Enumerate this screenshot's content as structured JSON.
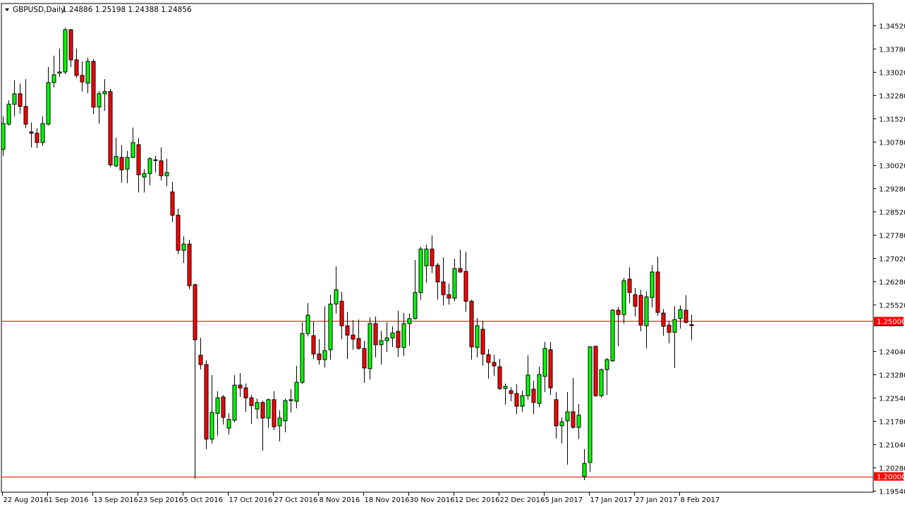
{
  "header": {
    "symbol": "GBPUSD,Daily",
    "ohlc_text": "1.24886 1.25198 1.24388 1.24856"
  },
  "colors": {
    "bull": "#00ff00",
    "bear": "#ff0000",
    "outline": "#000000",
    "hline": "#ff0000"
  },
  "chart_data": {
    "type": "candlestick",
    "title": "GBPUSD,Daily",
    "ylim": [
      1.1954,
      1.35
    ],
    "y_ticks": [
      "1.34520",
      "1.33780",
      "1.33020",
      "1.32280",
      "1.31520",
      "1.30780",
      "1.30020",
      "1.29280",
      "1.28520",
      "1.27780",
      "1.27020",
      "1.26280",
      "1.25520",
      "1.24040",
      "1.23280",
      "1.22540",
      "1.21780",
      "1.21040",
      "1.20280",
      "1.19540"
    ],
    "x_ticks": [
      {
        "label": "22 Aug 2016",
        "index": 0
      },
      {
        "label": "1 Sep 2016",
        "index": 8
      },
      {
        "label": "13 Sep 2016",
        "index": 16
      },
      {
        "label": "23 Sep 2016",
        "index": 24
      },
      {
        "label": "5 Oct 2016",
        "index": 32
      },
      {
        "label": "17 Oct 2016",
        "index": 40
      },
      {
        "label": "27 Oct 2016",
        "index": 48
      },
      {
        "label": "8 Nov 2016",
        "index": 56
      },
      {
        "label": "18 Nov 2016",
        "index": 64
      },
      {
        "label": "30 Nov 2016",
        "index": 72
      },
      {
        "label": "12 Dec 2016",
        "index": 80
      },
      {
        "label": "22 Dec 2016",
        "index": 88
      },
      {
        "label": "5 Jan 2017",
        "index": 96
      },
      {
        "label": "17 Jan 2017",
        "index": 104
      },
      {
        "label": "27 Jan 2017",
        "index": 112
      },
      {
        "label": "8 Feb 2017",
        "index": 120
      }
    ],
    "horizontal_lines": [
      {
        "price": 1.25,
        "label": "1.25000"
      },
      {
        "price": 1.2,
        "label": "1.20000"
      }
    ],
    "last_price": {
      "price": 1.24856,
      "label": "1.24856"
    },
    "ohlc_fields": [
      "open",
      "high",
      "low",
      "close"
    ],
    "candles": [
      [
        1.3053,
        1.3159,
        1.3032,
        1.3136
      ],
      [
        1.3134,
        1.3211,
        1.313,
        1.3198
      ],
      [
        1.3198,
        1.3275,
        1.3159,
        1.3232
      ],
      [
        1.3232,
        1.3264,
        1.3168,
        1.3191
      ],
      [
        1.3191,
        1.3279,
        1.3121,
        1.3134
      ],
      [
        1.3109,
        1.3139,
        1.3059,
        1.3105
      ],
      [
        1.3105,
        1.3121,
        1.3057,
        1.3075
      ],
      [
        1.3075,
        1.3159,
        1.3064,
        1.3136
      ],
      [
        1.3134,
        1.3318,
        1.313,
        1.3268
      ],
      [
        1.3268,
        1.3354,
        1.3252,
        1.3293
      ],
      [
        1.3298,
        1.3377,
        1.3286,
        1.3302
      ],
      [
        1.3302,
        1.3445,
        1.3295,
        1.3438
      ],
      [
        1.3438,
        1.3441,
        1.3318,
        1.3341
      ],
      [
        1.3341,
        1.3377,
        1.3284,
        1.3291
      ],
      [
        1.3291,
        1.3336,
        1.3239,
        1.327
      ],
      [
        1.3266,
        1.3348,
        1.3234,
        1.3336
      ],
      [
        1.3336,
        1.3343,
        1.3166,
        1.3189
      ],
      [
        1.3189,
        1.3241,
        1.3136,
        1.3232
      ],
      [
        1.3232,
        1.3279,
        1.3177,
        1.3239
      ],
      [
        1.3239,
        1.3248,
        1.2996,
        1.3003
      ],
      [
        1.3,
        1.3091,
        1.2996,
        1.303
      ],
      [
        1.3027,
        1.3066,
        1.2946,
        1.2987
      ],
      [
        1.2989,
        1.3048,
        1.2944,
        1.3027
      ],
      [
        1.3027,
        1.3123,
        1.3025,
        1.3075
      ],
      [
        1.3068,
        1.3089,
        1.2914,
        1.2971
      ],
      [
        1.2964,
        1.2989,
        1.2914,
        1.2975
      ],
      [
        1.2975,
        1.3027,
        1.2937,
        1.3023
      ],
      [
        1.3018,
        1.3032,
        1.2978,
        1.3019
      ],
      [
        1.3016,
        1.3059,
        1.2953,
        1.2968
      ],
      [
        1.2968,
        1.3023,
        1.2934,
        1.2978
      ],
      [
        1.2916,
        1.2948,
        1.2819,
        1.2841
      ],
      [
        1.2841,
        1.2862,
        1.2716,
        1.2728
      ],
      [
        1.2728,
        1.2773,
        1.2687,
        1.2748
      ],
      [
        1.2748,
        1.2762,
        1.2603,
        1.2614
      ],
      [
        1.2617,
        1.2621,
        1.1992,
        1.244
      ],
      [
        1.239,
        1.2446,
        1.2344,
        1.236
      ],
      [
        1.236,
        1.2374,
        1.2088,
        1.212
      ],
      [
        1.212,
        1.2326,
        1.2106,
        1.2206
      ],
      [
        1.2203,
        1.2274,
        1.2131,
        1.2253
      ],
      [
        1.2256,
        1.2262,
        1.2167,
        1.219
      ],
      [
        1.2156,
        1.2203,
        1.2135,
        1.2183
      ],
      [
        1.2181,
        1.2326,
        1.2174,
        1.2294
      ],
      [
        1.2294,
        1.2333,
        1.2256,
        1.2285
      ],
      [
        1.2285,
        1.2299,
        1.2208,
        1.2253
      ],
      [
        1.2253,
        1.2262,
        1.2169,
        1.2228
      ],
      [
        1.2217,
        1.2251,
        1.2185,
        1.2238
      ],
      [
        1.2238,
        1.2244,
        1.2083,
        1.2188
      ],
      [
        1.2188,
        1.2251,
        1.2156,
        1.2247
      ],
      [
        1.2247,
        1.2274,
        1.2149,
        1.216
      ],
      [
        1.2163,
        1.2213,
        1.2113,
        1.2188
      ],
      [
        1.2179,
        1.2251,
        1.2142,
        1.2244
      ],
      [
        1.2244,
        1.2281,
        1.2206,
        1.2247
      ],
      [
        1.2242,
        1.2356,
        1.2219,
        1.2303
      ],
      [
        1.2303,
        1.2496,
        1.2297,
        1.246
      ],
      [
        1.246,
        1.2558,
        1.2451,
        1.2519
      ],
      [
        1.2453,
        1.2499,
        1.2378,
        1.2394
      ],
      [
        1.2394,
        1.2442,
        1.236,
        1.2376
      ],
      [
        1.2376,
        1.2548,
        1.2351,
        1.2405
      ],
      [
        1.2408,
        1.2585,
        1.2376,
        1.2555
      ],
      [
        1.2555,
        1.2676,
        1.2524,
        1.2601
      ],
      [
        1.2564,
        1.2594,
        1.2442,
        1.2485
      ],
      [
        1.2485,
        1.253,
        1.2378,
        1.2455
      ],
      [
        1.2455,
        1.2503,
        1.2408,
        1.2442
      ],
      [
        1.2444,
        1.2505,
        1.2408,
        1.2412
      ],
      [
        1.2412,
        1.2437,
        1.2301,
        1.2349
      ],
      [
        1.2347,
        1.2512,
        1.2312,
        1.2492
      ],
      [
        1.2492,
        1.2515,
        1.2383,
        1.2424
      ],
      [
        1.2424,
        1.2469,
        1.236,
        1.2437
      ],
      [
        1.2437,
        1.2496,
        1.2401,
        1.2446
      ],
      [
        1.2446,
        1.2483,
        1.2417,
        1.2462
      ],
      [
        1.2467,
        1.2533,
        1.2385,
        1.2415
      ],
      [
        1.2415,
        1.2526,
        1.2387,
        1.2492
      ],
      [
        1.2492,
        1.2524,
        1.2421,
        1.2508
      ],
      [
        1.2508,
        1.2696,
        1.2505,
        1.2592
      ],
      [
        1.2592,
        1.2739,
        1.2569,
        1.2732
      ],
      [
        1.2678,
        1.2746,
        1.2623,
        1.2732
      ],
      [
        1.2732,
        1.2776,
        1.2655,
        1.2678
      ],
      [
        1.268,
        1.2687,
        1.2569,
        1.2626
      ],
      [
        1.2626,
        1.2705,
        1.2551,
        1.2585
      ],
      [
        1.2585,
        1.2621,
        1.2553,
        1.2574
      ],
      [
        1.2574,
        1.2701,
        1.2564,
        1.2669
      ],
      [
        1.2669,
        1.273,
        1.2655,
        1.2658
      ],
      [
        1.266,
        1.2723,
        1.253,
        1.2564
      ],
      [
        1.2564,
        1.2569,
        1.2376,
        1.2417
      ],
      [
        1.2415,
        1.251,
        1.2383,
        1.2485
      ],
      [
        1.2474,
        1.2501,
        1.2356,
        1.2394
      ],
      [
        1.2392,
        1.241,
        1.2315,
        1.2367
      ],
      [
        1.2367,
        1.2392,
        1.2324,
        1.2356
      ],
      [
        1.2353,
        1.2378,
        1.2278,
        1.2283
      ],
      [
        1.2283,
        1.2299,
        1.2231,
        1.229
      ],
      [
        1.2276,
        1.2287,
        1.2242,
        1.2267
      ],
      [
        1.2267,
        1.2297,
        1.2201,
        1.2226
      ],
      [
        1.2226,
        1.2276,
        1.2208,
        1.226
      ],
      [
        1.226,
        1.239,
        1.2247,
        1.2326
      ],
      [
        1.2281,
        1.2308,
        1.2201,
        1.2238
      ],
      [
        1.2235,
        1.2353,
        1.2222,
        1.2328
      ],
      [
        1.2322,
        1.2433,
        1.2272,
        1.2412
      ],
      [
        1.2408,
        1.2433,
        1.2262,
        1.2285
      ],
      [
        1.2247,
        1.2272,
        1.2122,
        1.2163
      ],
      [
        1.2163,
        1.219,
        1.2106,
        1.2176
      ],
      [
        1.2179,
        1.2272,
        1.2038,
        1.2208
      ],
      [
        1.2208,
        1.2317,
        1.2154,
        1.2158
      ],
      [
        1.2158,
        1.2233,
        1.212,
        1.2197
      ],
      [
        1.1999,
        1.2088,
        1.1988,
        1.2042
      ],
      [
        1.2045,
        1.2419,
        1.2015,
        1.2417
      ],
      [
        1.2419,
        1.242,
        1.2256,
        1.226
      ],
      [
        1.226,
        1.2347,
        1.2253,
        1.2344
      ],
      [
        1.2344,
        1.2381,
        1.2262,
        1.2376
      ],
      [
        1.2372,
        1.2539,
        1.2369,
        1.2535
      ],
      [
        1.2535,
        1.2546,
        1.2419,
        1.2521
      ],
      [
        1.2521,
        1.2639,
        1.2492,
        1.263
      ],
      [
        1.2635,
        1.2673,
        1.2558,
        1.2592
      ],
      [
        1.2585,
        1.2607,
        1.2515,
        1.2548
      ],
      [
        1.2583,
        1.2601,
        1.2467,
        1.2487
      ],
      [
        1.2485,
        1.2596,
        1.2412,
        1.2578
      ],
      [
        1.2576,
        1.268,
        1.2544,
        1.2658
      ],
      [
        1.2658,
        1.2707,
        1.2517,
        1.2528
      ],
      [
        1.2526,
        1.2539,
        1.2453,
        1.2483
      ],
      [
        1.2487,
        1.2499,
        1.2428,
        1.2464
      ],
      [
        1.2464,
        1.2548,
        1.2349,
        1.2505
      ],
      [
        1.2508,
        1.2551,
        1.2476,
        1.2537
      ],
      [
        1.2535,
        1.2583,
        1.2492,
        1.2496
      ],
      [
        1.24886,
        1.25198,
        1.24388,
        1.24856
      ]
    ]
  }
}
